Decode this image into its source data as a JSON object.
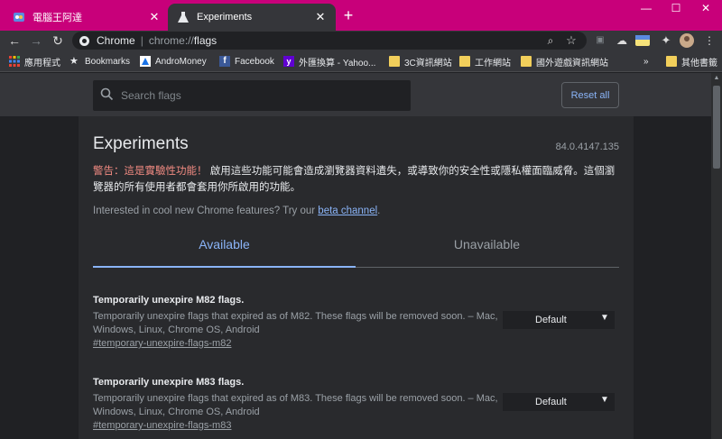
{
  "tabs": [
    {
      "title": "電腦王阿達",
      "icon": "site-favicon"
    },
    {
      "title": "Experiments",
      "icon": "flask-icon"
    }
  ],
  "omnibox": {
    "site_label": "Chrome",
    "url_scheme": "chrome://",
    "url_path": "flags"
  },
  "bookmarks": {
    "apps": "應用程式",
    "items": [
      "Bookmarks",
      "AndroMoney",
      "Facebook",
      "外匯換算 - Yahoo...",
      "3C資訊網站",
      "工作網站",
      "國外遊戲資訊網站"
    ],
    "overflow": "»",
    "other": "其他書籤"
  },
  "search": {
    "placeholder": "Search flags",
    "reset_label": "Reset all"
  },
  "page": {
    "title": "Experiments",
    "version": "84.0.4147.135",
    "warning_label": "警告：這是實驗性功能！",
    "warning_text": "啟用這些功能可能會造成瀏覽器資料遺失，或導致你的安全性或隱私權面臨威脅。這個瀏覽器的所有使用者都會套用你所啟用的功能。",
    "interest_text": "Interested in cool new Chrome features? Try our ",
    "interest_link": "beta channel",
    "interest_end": ".",
    "tab_available": "Available",
    "tab_unavailable": "Unavailable"
  },
  "flags": [
    {
      "name": "Temporarily unexpire M82 flags.",
      "desc": "Temporarily unexpire flags that expired as of M82. These flags will be removed soon. – Mac, Windows, Linux, Chrome OS, Android",
      "link": "#temporary-unexpire-flags-m82",
      "value": "Default"
    },
    {
      "name": "Temporarily unexpire M83 flags.",
      "desc": "Temporarily unexpire flags that expired as of M83. These flags will be removed soon. – Mac, Windows, Linux, Chrome OS, Android",
      "link": "#temporary-unexpire-flags-m83",
      "value": "Default"
    }
  ],
  "colors": {
    "tabstrip": "#c8007a",
    "accent": "#8ab4f8",
    "warning": "#f28b82",
    "background": "#202124"
  }
}
